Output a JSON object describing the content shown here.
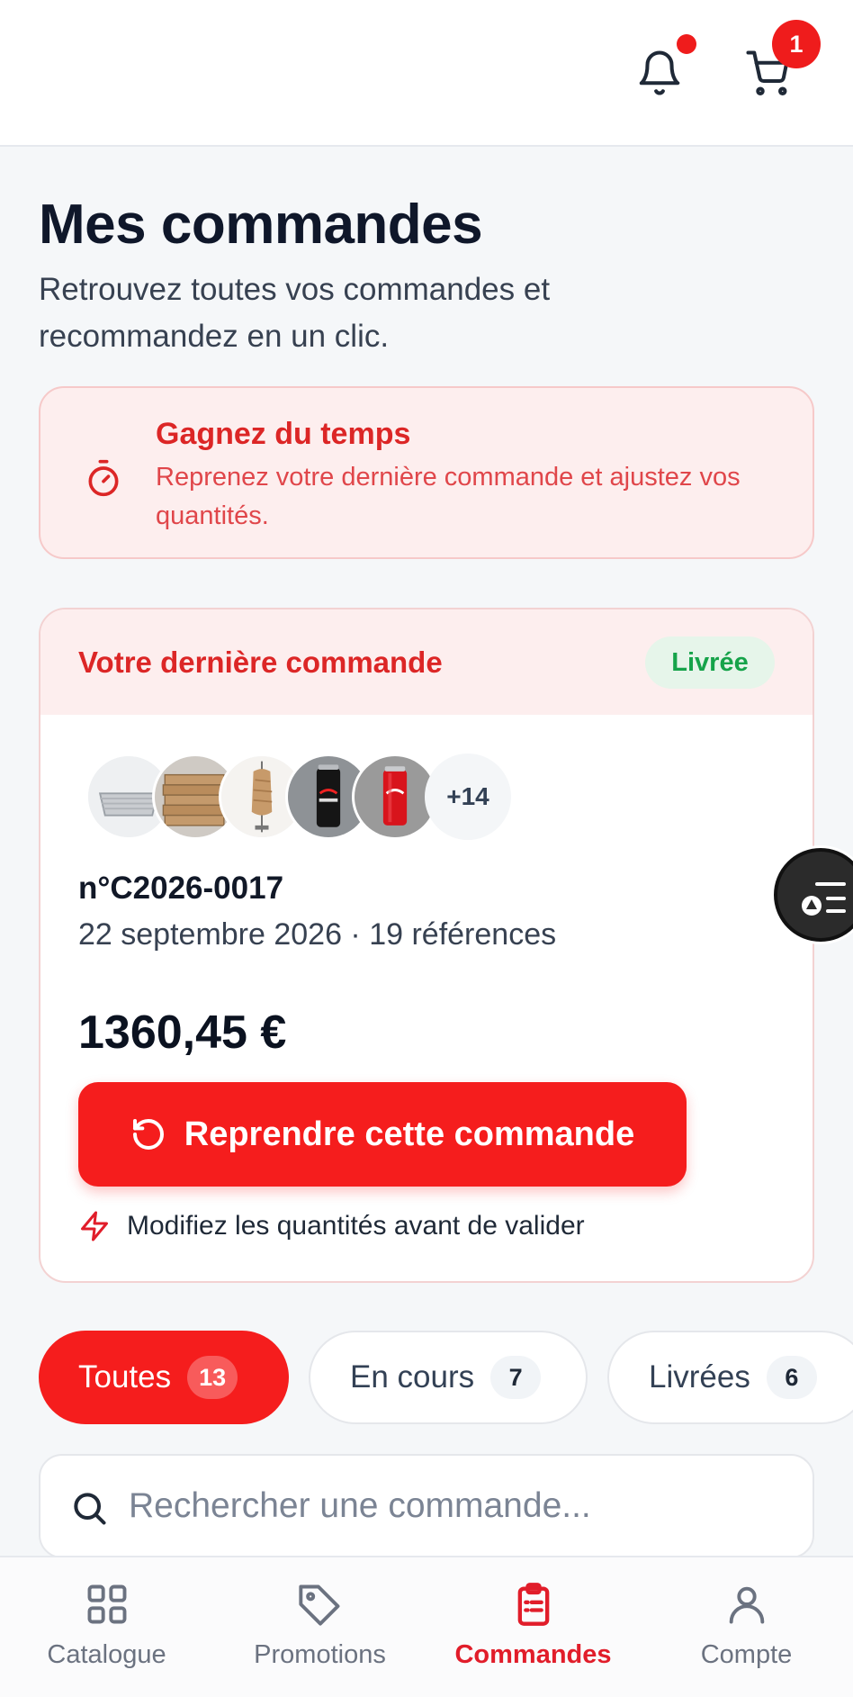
{
  "header": {
    "notification_dot": true,
    "cart_count": "1"
  },
  "page": {
    "title": "Mes commandes",
    "subtitle": "Retrouvez toutes vos commandes et recommandez en un clic."
  },
  "tip": {
    "title": "Gagnez du temps",
    "text": "Reprenez votre dernière commande et ajustez vos quantités.",
    "icon": "stopwatch-icon"
  },
  "last_order": {
    "heading": "Votre dernière commande",
    "status": "Livrée",
    "thumbnails": [
      "aluminium-trays",
      "pizza-boxes",
      "kebab-skewer",
      "coca-cola-zero-can",
      "coca-cola-can"
    ],
    "more_count": "+14",
    "number": "n°C2026-0017",
    "meta": "22 septembre 2026 · 19 références",
    "total": "1360,45 €",
    "reorder_label": "Reprendre cette commande",
    "hint": "Modifiez les quantités avant de valider"
  },
  "filters": [
    {
      "label": "Toutes",
      "count": "13",
      "active": true
    },
    {
      "label": "En cours",
      "count": "7",
      "active": false
    },
    {
      "label": "Livrées",
      "count": "6",
      "active": false
    }
  ],
  "search": {
    "placeholder": "Rechercher une commande..."
  },
  "nav": [
    {
      "label": "Catalogue",
      "icon": "grid-icon",
      "active": false
    },
    {
      "label": "Promotions",
      "icon": "tag-icon",
      "active": false
    },
    {
      "label": "Commandes",
      "icon": "clipboard-list-icon",
      "active": true
    },
    {
      "label": "Compte",
      "icon": "user-icon",
      "active": false
    }
  ],
  "colors": {
    "accent": "#f51d1d",
    "accent_text": "#dc2626",
    "success": "#16a34a",
    "tip_bg": "#fdeeee",
    "page_bg": "#f5f7f9"
  }
}
